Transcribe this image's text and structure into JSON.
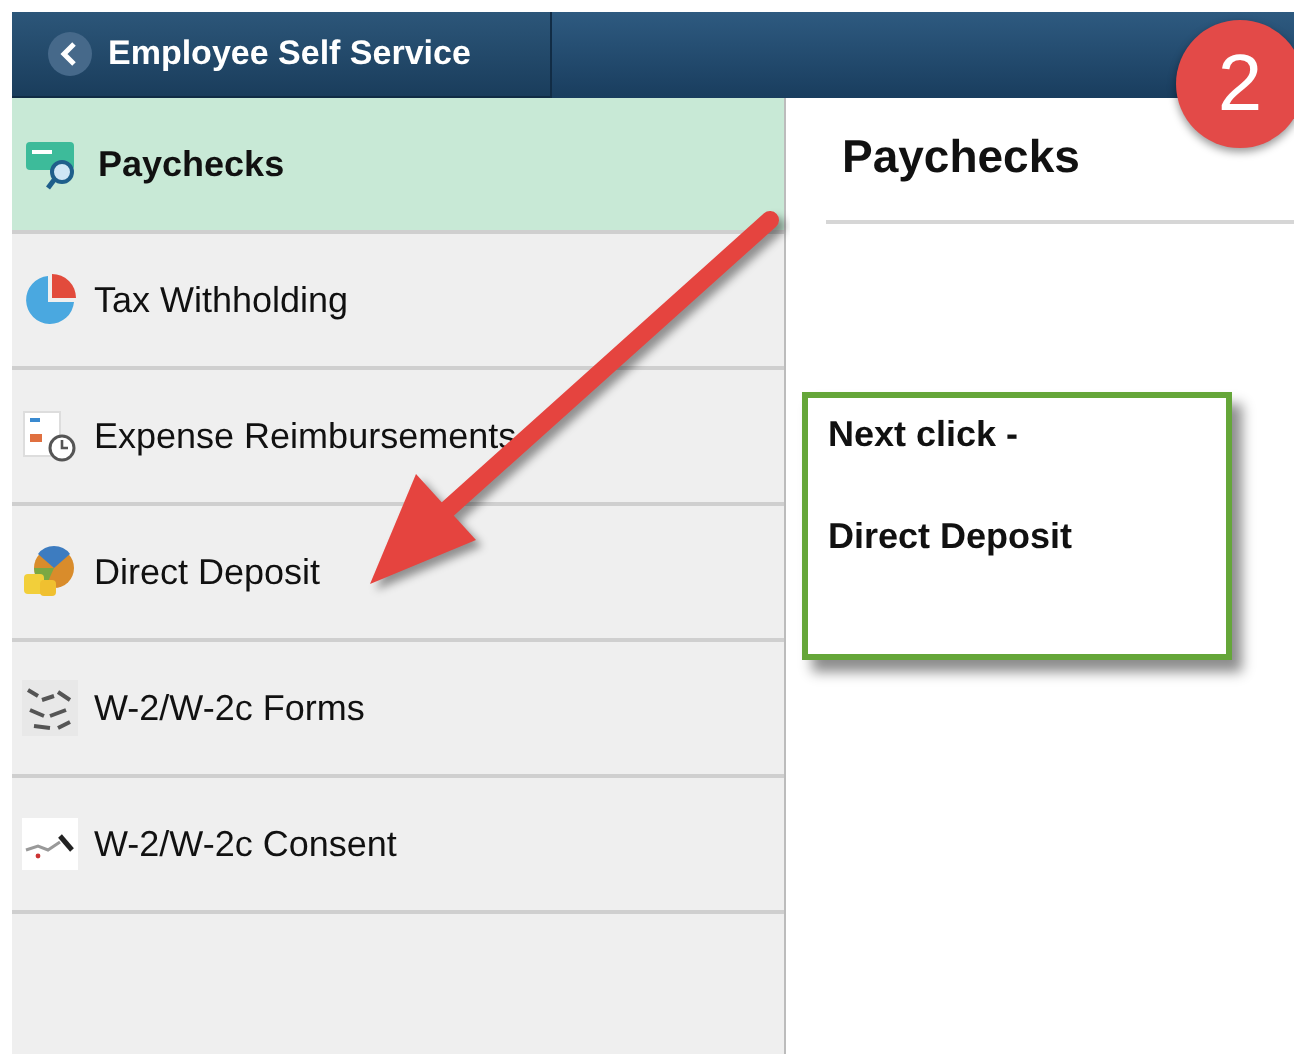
{
  "header": {
    "back_label": "Employee Self Service"
  },
  "sidebar": {
    "items": [
      {
        "label": "Paychecks",
        "selected": true
      },
      {
        "label": "Tax Withholding",
        "selected": false
      },
      {
        "label": "Expense Reimbursements",
        "selected": false
      },
      {
        "label": "Direct Deposit",
        "selected": false
      },
      {
        "label": "W-2/W-2c Forms",
        "selected": false
      },
      {
        "label": "W-2/W-2c Consent",
        "selected": false
      }
    ]
  },
  "content": {
    "title": "Paychecks"
  },
  "callout": {
    "lines": [
      "Next click -",
      "Direct Deposit"
    ]
  },
  "step_badge": "2"
}
